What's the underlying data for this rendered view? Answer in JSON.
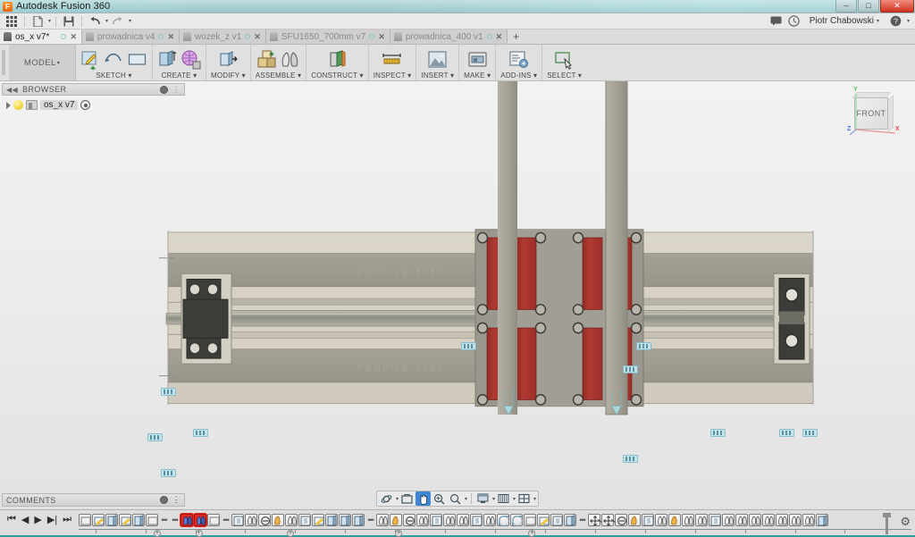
{
  "window": {
    "app_title": "Autodesk Fusion 360",
    "logo_glyph": "F",
    "minimize": "–",
    "maximize": "□",
    "close": "✕"
  },
  "quick_access": {
    "buttons": [
      {
        "name": "app-grid-icon",
        "glyph": "▒"
      },
      {
        "name": "new-document-icon",
        "glyph": "▤",
        "caret": true
      },
      {
        "name": "save-icon",
        "glyph": "Ὃe",
        "caret": false
      },
      {
        "name": "undo-icon",
        "glyph": "↩",
        "caret": true
      },
      {
        "name": "redo-icon",
        "glyph": "↪",
        "caret": true
      }
    ]
  },
  "account": {
    "messages_icon": "✉",
    "history_icon": "◴",
    "user_name": "Piotr Chabowski",
    "help_icon": "?"
  },
  "tabs": [
    {
      "label": "os_x v7*",
      "active": true
    },
    {
      "label": "prowadnica v4",
      "active": false
    },
    {
      "label": "wozek_z v1",
      "active": false
    },
    {
      "label": "SFU1650_700mm v7",
      "active": false
    },
    {
      "label": "prowadnica_400 v1",
      "active": false
    }
  ],
  "tab_add_label": "+",
  "ribbon": {
    "workspace": "MODEL",
    "groups": [
      {
        "label": "SKETCH",
        "icons": [
          "create-sketch-icon",
          "sketch-line-icon",
          "sketch-rectangle-icon"
        ]
      },
      {
        "label": "CREATE",
        "icons": [
          "extrude-icon",
          "mesh-icon"
        ]
      },
      {
        "label": "MODIFY",
        "icons": [
          "press-pull-icon"
        ]
      },
      {
        "label": "ASSEMBLE",
        "icons": [
          "new-component-icon",
          "joint-icon"
        ]
      },
      {
        "label": "CONSTRUCT",
        "icons": [
          "offset-plane-icon"
        ]
      },
      {
        "label": "INSPECT",
        "icons": [
          "measure-icon"
        ]
      },
      {
        "label": "INSERT",
        "icons": [
          "insert-mcmaster-icon"
        ]
      },
      {
        "label": "MAKE",
        "icons": [
          "3d-print-icon"
        ]
      },
      {
        "label": "ADD-INS",
        "icons": [
          "scripts-addins-icon"
        ]
      },
      {
        "label": "SELECT",
        "icons": [
          "select-cursor-icon"
        ]
      }
    ]
  },
  "browser": {
    "title": "BROWSER",
    "collapse_icon": "◀◀",
    "settings_icon": "⊖",
    "grip_icon": "⋮",
    "root": {
      "label": "os_x v7",
      "expand_icon": "▷",
      "visibility_icon": "light-bulb-icon",
      "component_icon": "component-icon",
      "state_icon": "activate-icon"
    }
  },
  "viewcube": {
    "face_label": "FRONT",
    "axis_x": "X",
    "axis_y": "Y",
    "axis_z": "Z"
  },
  "comments": {
    "title": "COMMENTS",
    "settings_icon": "⊖",
    "grip_icon": "⋮"
  },
  "navbar": {
    "buttons": [
      {
        "name": "orbit-icon",
        "glyph": "⊕",
        "caret": true,
        "active": false
      },
      {
        "name": "look-at-icon",
        "glyph": "▣",
        "caret": false,
        "active": false
      },
      {
        "name": "pan-icon",
        "glyph": "✋",
        "caret": false,
        "active": true
      },
      {
        "name": "zoom-window-icon",
        "glyph": "⌕",
        "caret": false,
        "active": false
      },
      {
        "name": "zoom-icon",
        "glyph": "⌕",
        "caret": true,
        "active": false
      },
      {
        "name": "display-settings-icon",
        "glyph": "▧",
        "caret": true,
        "active": false
      },
      {
        "name": "grid-snaps-icon",
        "glyph": "⌸",
        "caret": true,
        "active": false
      },
      {
        "name": "viewports-icon",
        "glyph": "⊞",
        "caret": true,
        "active": false
      }
    ]
  },
  "timeline": {
    "playback": [
      {
        "name": "go-to-beginning-button",
        "glyph": "⏮"
      },
      {
        "name": "step-back-button",
        "glyph": "◀"
      },
      {
        "name": "play-button",
        "glyph": "▶"
      },
      {
        "name": "step-forward-button",
        "glyph": "▶|"
      },
      {
        "name": "go-to-end-button",
        "glyph": "⏭"
      }
    ],
    "settings_icon": "⚙",
    "features": [
      {
        "type": "sketch",
        "selected": false
      },
      {
        "type": "sketch-yellow",
        "selected": false
      },
      {
        "type": "extrude",
        "selected": false
      },
      {
        "type": "sketch-yellow",
        "selected": false
      },
      {
        "type": "extrude",
        "selected": false
      },
      {
        "type": "sketch",
        "selected": false
      },
      {
        "type": "dots",
        "selected": false
      },
      {
        "type": "dots",
        "selected": false
      },
      {
        "type": "joint",
        "selected": true
      },
      {
        "type": "joint",
        "selected": true
      },
      {
        "type": "sketch",
        "selected": false
      },
      {
        "type": "dots",
        "selected": false
      },
      {
        "type": "component",
        "selected": false
      },
      {
        "type": "mirror",
        "selected": false
      },
      {
        "type": "rigid",
        "selected": false
      },
      {
        "type": "asbuilt",
        "selected": false
      },
      {
        "type": "asbuilt",
        "selected": false
      },
      {
        "type": "component",
        "selected": false
      },
      {
        "type": "sketch-yellow",
        "selected": false
      },
      {
        "type": "extrude",
        "selected": false
      },
      {
        "type": "extrude",
        "selected": false
      },
      {
        "type": "extrude",
        "selected": false
      },
      {
        "type": "dots",
        "selected": false
      },
      {
        "type": "mirror",
        "selected": false
      },
      {
        "type": "asbuilt",
        "selected": false
      },
      {
        "type": "rigid",
        "selected": false
      },
      {
        "type": "asbuilt",
        "selected": false
      },
      {
        "type": "component",
        "selected": false
      },
      {
        "type": "mirror",
        "selected": false
      },
      {
        "type": "mirror",
        "selected": false
      },
      {
        "type": "component",
        "selected": false
      },
      {
        "type": "mirror",
        "selected": false
      },
      {
        "type": "fillet",
        "selected": false
      },
      {
        "type": "fillet",
        "selected": false
      },
      {
        "type": "sketch",
        "selected": false
      },
      {
        "type": "sketch-yellow",
        "selected": false
      },
      {
        "type": "component",
        "selected": false
      },
      {
        "type": "extrude",
        "selected": false
      },
      {
        "type": "dots",
        "selected": false
      },
      {
        "type": "move",
        "selected": false
      },
      {
        "type": "move",
        "selected": false
      },
      {
        "type": "rigid",
        "selected": false
      },
      {
        "type": "asbuilt",
        "selected": false
      },
      {
        "type": "component",
        "selected": false
      },
      {
        "type": "mirror",
        "selected": false
      },
      {
        "type": "asbuilt",
        "selected": false
      },
      {
        "type": "asbuilt",
        "selected": false
      },
      {
        "type": "mirror",
        "selected": false
      },
      {
        "type": "component",
        "selected": false
      },
      {
        "type": "asbuilt",
        "selected": false
      },
      {
        "type": "mirror",
        "selected": false
      },
      {
        "type": "mirror",
        "selected": false
      },
      {
        "type": "asbuilt",
        "selected": false
      },
      {
        "type": "asbuilt",
        "selected": false
      },
      {
        "type": "mirror",
        "selected": false
      },
      {
        "type": "mirror",
        "selected": false
      },
      {
        "type": "extrude",
        "selected": false
      }
    ]
  },
  "model": {
    "description": "CNC linear X-axis gantry assembly, front orthographic view",
    "colors": {
      "extrusion": "#d8d3c4",
      "extrusion_dark": "#9d9a8d",
      "plate_gray": "#9a978e",
      "bearing_red": "#ab332c",
      "motor_black": "#3c3d38",
      "shaft": "#a6a59c",
      "post": "#a8a498",
      "joint_marker": "#bfe4ec"
    },
    "parts": [
      {
        "name": "x-axis-extrusion-rail",
        "count": 1
      },
      {
        "name": "ballscrew-shaft",
        "count": 1
      },
      {
        "name": "motor-mount-plate",
        "count": 1
      },
      {
        "name": "bearing-block-left",
        "count": 1
      },
      {
        "name": "bearing-block-right",
        "count": 1
      },
      {
        "name": "gantry-carriage-plate",
        "count": 1
      },
      {
        "name": "linear-bearing-red",
        "count": 8
      },
      {
        "name": "gantry-upright-post",
        "count": 2
      }
    ]
  }
}
